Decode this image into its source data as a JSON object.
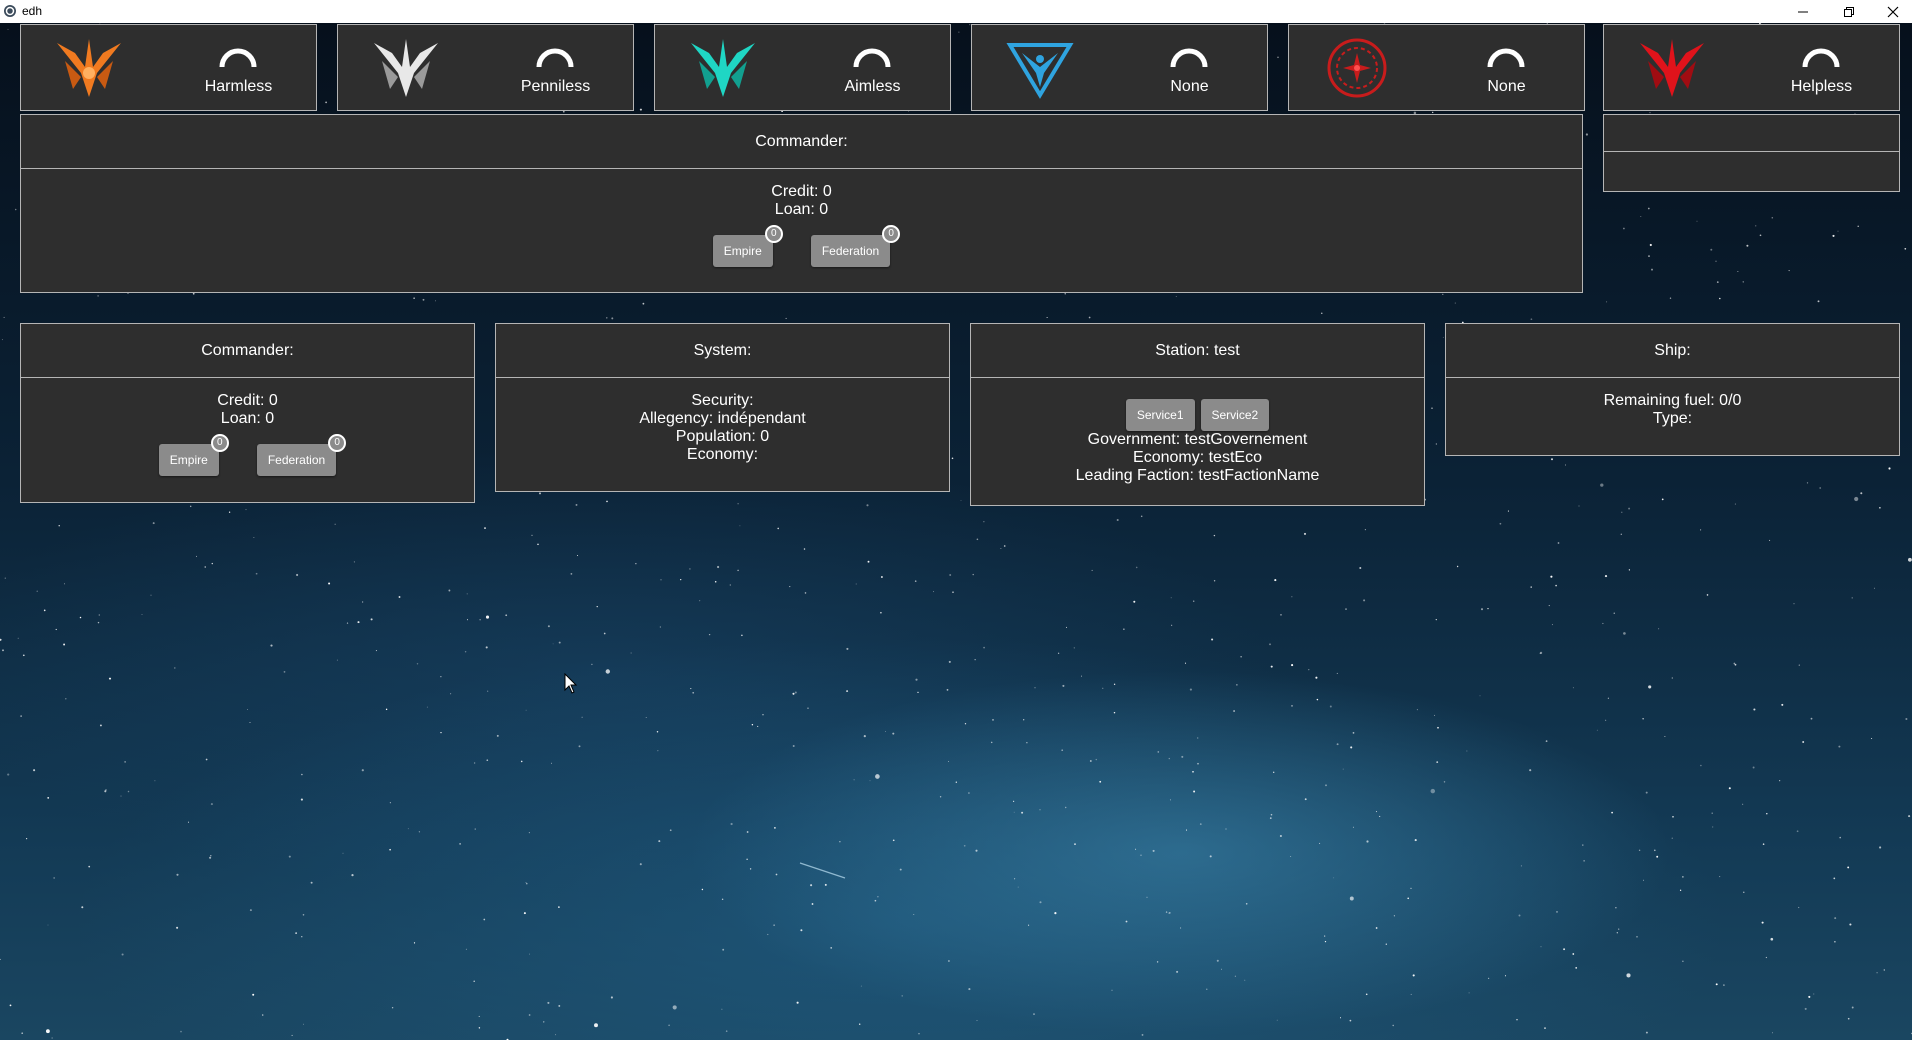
{
  "window": {
    "title": "edh",
    "controls": {
      "minimize_icon": "minimize-icon",
      "restore_icon": "restore-icon",
      "close_icon": "close-icon"
    }
  },
  "ranks": [
    {
      "emblem": "empire-wings-icon",
      "color": "#f07a20",
      "label": "Harmless"
    },
    {
      "emblem": "trade-wings-icon",
      "color": "#e8e8e8",
      "label": "Penniless"
    },
    {
      "emblem": "explorer-wings-icon",
      "color": "#1fd6c4",
      "label": "Aimless"
    },
    {
      "emblem": "federation-icon",
      "color": "#2fa4e0",
      "label": "None"
    },
    {
      "emblem": "empire-seal-icon",
      "color": "#c81c1c",
      "label": "None"
    },
    {
      "emblem": "cqc-wings-icon",
      "color": "#e0131b",
      "label": "Helpless"
    }
  ],
  "commander_main": {
    "title": "Commander:",
    "credit": "Credit: 0",
    "loan": "Loan: 0",
    "buttons": [
      {
        "label": "Empire",
        "badge": "0"
      },
      {
        "label": "Federation",
        "badge": "0"
      }
    ]
  },
  "commander": {
    "title": "Commander:",
    "credit": "Credit: 0",
    "loan": "Loan: 0",
    "buttons": [
      {
        "label": "Empire",
        "badge": "0"
      },
      {
        "label": "Federation",
        "badge": "0"
      }
    ]
  },
  "system": {
    "title": "System:",
    "security": "Security:",
    "allegency": "Allegency: indépendant",
    "population": "Population: 0",
    "economy": "Economy:"
  },
  "station": {
    "title": "Station: test",
    "services": [
      "Service1",
      "Service2"
    ],
    "government": "Government: testGovernement",
    "economy": "Economy: testEco",
    "leading_faction": "Leading Faction: testFactionName"
  },
  "ship": {
    "title": "Ship:",
    "fuel": "Remaining fuel: 0/0",
    "type": "Type:"
  }
}
